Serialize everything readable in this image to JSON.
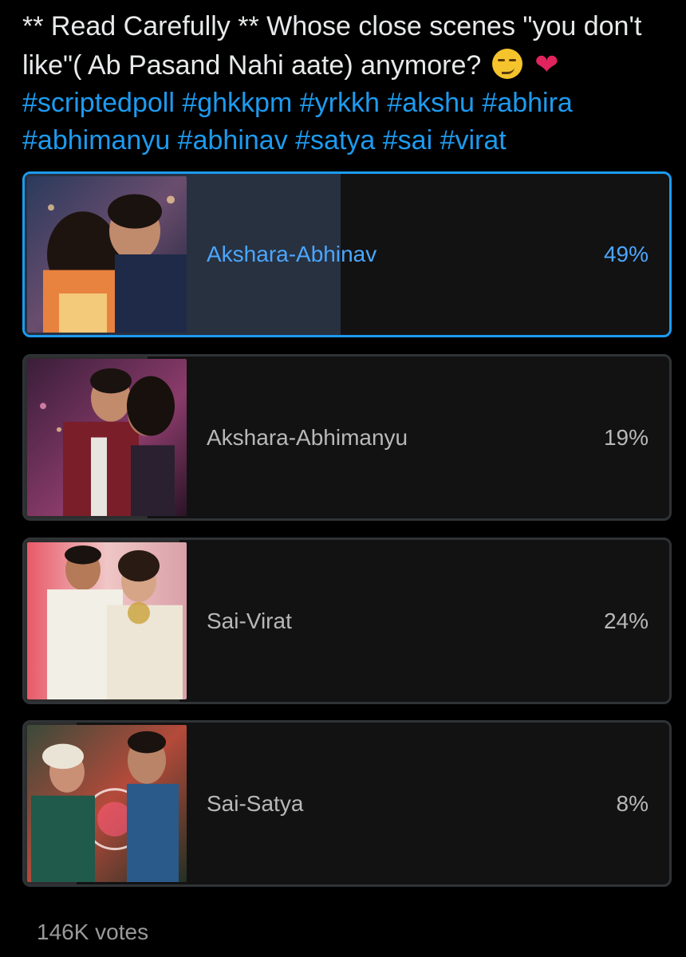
{
  "question": {
    "text": "** Read Carefully ** Whose close scenes \"you don't like\"( Ab Pasand Nahi aate) anymore?",
    "emoji_1": "smirk-emoji",
    "emoji_2": "red-heart-emoji",
    "hashtags": "#scriptedpoll #ghkkpm #yrkkh #akshu #abhira #abhimanyu #abhinav #satya #sai #virat"
  },
  "poll": {
    "options": [
      {
        "label": "Akshara-Abhinav",
        "percent": "49%",
        "value": 49,
        "selected": true
      },
      {
        "label": "Akshara-Abhimanyu",
        "percent": "19%",
        "value": 19,
        "selected": false
      },
      {
        "label": "Sai-Virat",
        "percent": "24%",
        "value": 24,
        "selected": false
      },
      {
        "label": "Sai-Satya",
        "percent": "8%",
        "value": 8,
        "selected": false
      }
    ],
    "votes": "146K votes"
  },
  "colors": {
    "accent": "#1d9bf0",
    "selected_text": "#4ca6ff",
    "selected_fill": "#273140",
    "fill": "#2d2d2d",
    "text": "#e7e9ea"
  }
}
